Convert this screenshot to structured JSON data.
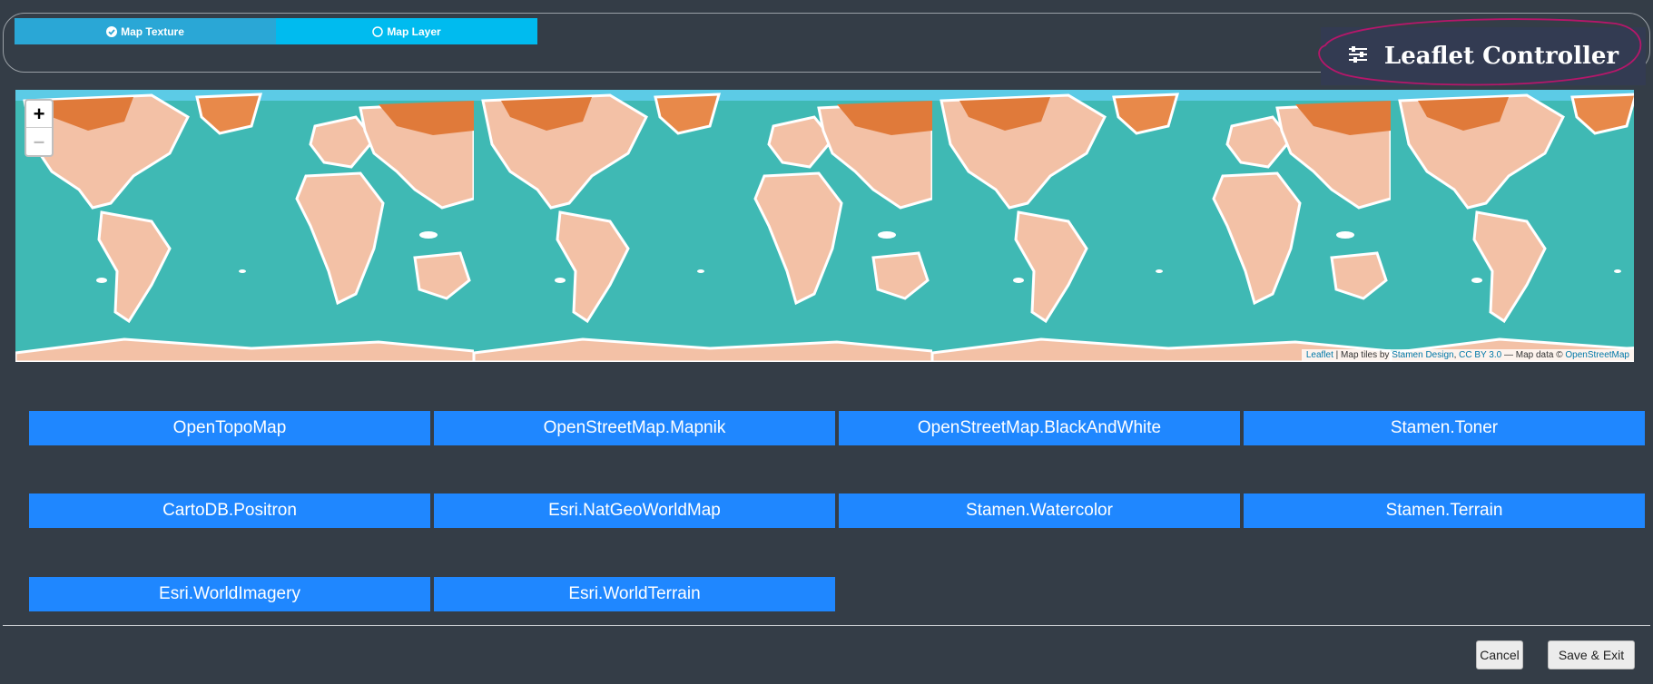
{
  "tabs": {
    "texture_label": "Map Texture",
    "layer_label": "Map Layer"
  },
  "controller": {
    "title": "Leaflet Controller"
  },
  "map": {
    "zoom_in": "+",
    "zoom_out": "–",
    "attribution": {
      "leaflet": "Leaflet",
      "sep1": " | Map tiles by ",
      "stamen": "Stamen Design",
      "sep2": ", ",
      "cc": "CC BY 3.0",
      "sep3": " — Map data © ",
      "osm": "OpenStreetMap"
    }
  },
  "layers": [
    "OpenTopoMap",
    "OpenStreetMap.Mapnik",
    "OpenStreetMap.BlackAndWhite",
    "Stamen.Toner",
    "CartoDB.Positron",
    "Esri.NatGeoWorldMap",
    "Stamen.Watercolor",
    "Stamen.Terrain",
    "Esri.WorldImagery",
    "Esri.WorldTerrain"
  ],
  "footer": {
    "cancel_label": "Cancel",
    "save_label": "Save & Exit"
  },
  "colors": {
    "background": "#343d47",
    "tab_active": "#2aa7d6",
    "tab_inactive": "#00bbef",
    "layer_button": "#1f87ff",
    "ocean": "#3fb9b4",
    "land": "#f3c1a6",
    "land_dark": "#e07a3a"
  }
}
